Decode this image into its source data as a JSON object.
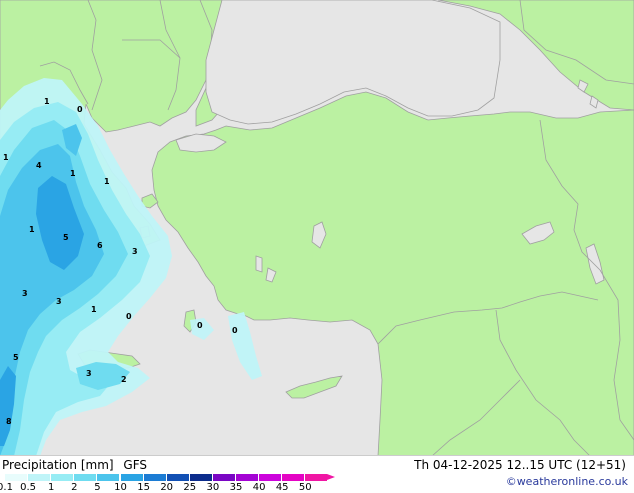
{
  "title": "Precipitation [mm]",
  "model": "GFS",
  "datetime": "Th 04-12-2025 12..15 UTC (12+51)",
  "credit": "©weatheronline.co.uk",
  "colors": {
    "land": "#bbf1a2",
    "sea": "#e6e6e6",
    "border": "#a0a0a0"
  },
  "legend": {
    "ticks": [
      "0.1",
      "0.5",
      "1",
      "2",
      "5",
      "10",
      "15",
      "20",
      "25",
      "30",
      "35",
      "40",
      "45",
      "50"
    ],
    "colors": [
      "#e8fcfc",
      "#bff4f8",
      "#97ecf4",
      "#6fdcf0",
      "#4cc4ec",
      "#2aa4e4",
      "#1c7cd4",
      "#1250b4",
      "#0c2c8c",
      "#7a06c4",
      "#a404d4",
      "#cc04dc",
      "#e404c4",
      "#f016a4"
    ]
  },
  "precip_labels": [
    {
      "v": "1"
    },
    {
      "v": "0"
    },
    {
      "v": "1"
    },
    {
      "v": "4"
    },
    {
      "v": "1"
    },
    {
      "v": "1"
    },
    {
      "v": "1"
    },
    {
      "v": "5"
    },
    {
      "v": "6"
    },
    {
      "v": "3"
    },
    {
      "v": "3"
    },
    {
      "v": "3"
    },
    {
      "v": "1"
    },
    {
      "v": "0"
    },
    {
      "v": "0"
    },
    {
      "v": "0"
    },
    {
      "v": "5"
    },
    {
      "v": "3"
    },
    {
      "v": "2"
    },
    {
      "v": "8"
    }
  ]
}
